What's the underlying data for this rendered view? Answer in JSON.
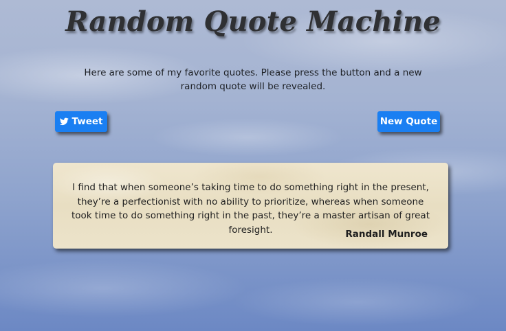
{
  "page": {
    "title": "Random Quote Machine",
    "intro": "Here are some of my favorite quotes. Please press the button and a new random quote will be revealed."
  },
  "buttons": {
    "tweet_label": "Tweet",
    "tweet_icon": "twitter-bird-icon",
    "new_quote_label": "New Quote",
    "accent_color": "#1a7ff2"
  },
  "quote": {
    "text": "I find that when someone’s taking time to do something right in the present, they’re a perfectionist with no ability to prioritize, whereas when someone took time to do something right in the past, they’re a master artisan of great foresight.",
    "author": "Randall Munroe"
  }
}
